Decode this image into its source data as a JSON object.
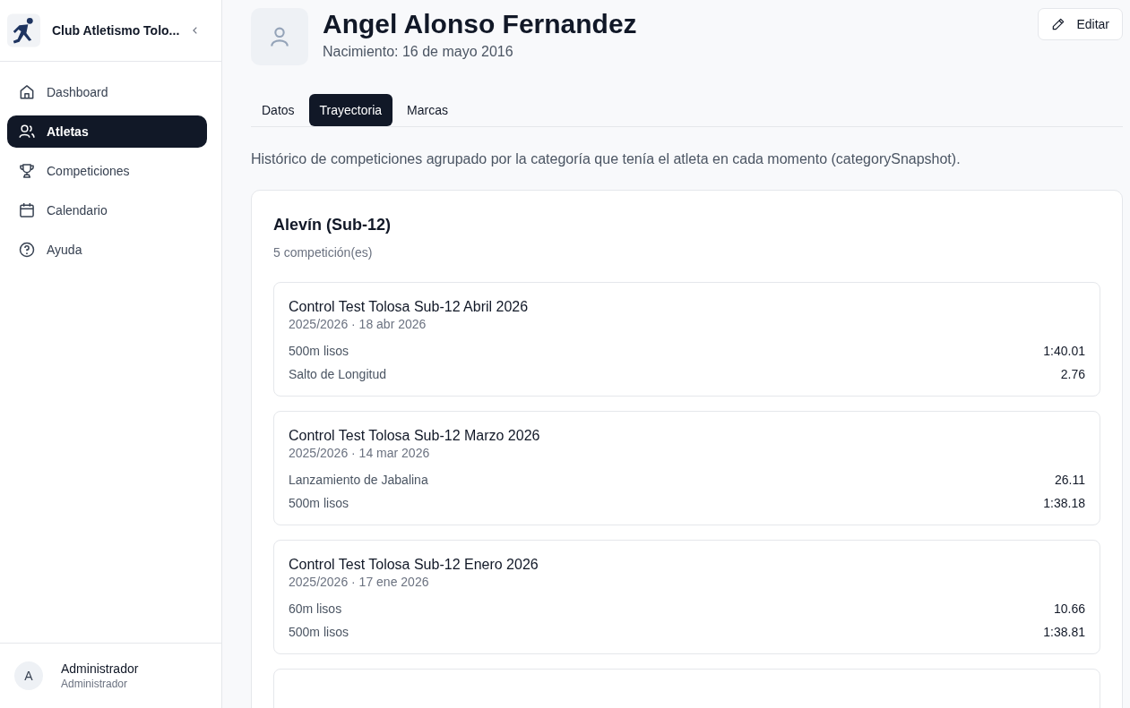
{
  "sidebar": {
    "club_name": "Club Atletismo Tolo...",
    "items": [
      {
        "label": "Dashboard",
        "selected": false
      },
      {
        "label": "Atletas",
        "selected": true
      },
      {
        "label": "Competiciones",
        "selected": false
      },
      {
        "label": "Calendario",
        "selected": false
      },
      {
        "label": "Ayuda",
        "selected": false
      }
    ],
    "user": {
      "initial": "A",
      "name": "Administrador",
      "role": "Administrador"
    }
  },
  "athlete": {
    "name": "Angel Alonso Fernandez",
    "birth": "Nacimiento: 16 de mayo 2016",
    "edit_button": "Editar"
  },
  "tabs": [
    {
      "label": "Datos",
      "selected": false
    },
    {
      "label": "Trayectoria",
      "selected": true
    },
    {
      "label": "Marcas",
      "selected": false
    }
  ],
  "description": "Histórico de competiciones agrupado por la categoría que tenía el atleta en cada momento (categorySnapshot).",
  "group": {
    "title": "Alevín (Sub-12)",
    "count": "5 competición(es)",
    "competitions": [
      {
        "name": "Control Test Tolosa Sub-12 Abril 2026",
        "meta": "2025/2026 · 18 abr 2026",
        "results": [
          {
            "event": "500m lisos",
            "mark": "1:40.01"
          },
          {
            "event": "Salto de Longitud",
            "mark": "2.76"
          }
        ]
      },
      {
        "name": "Control Test Tolosa Sub-12 Marzo 2026",
        "meta": "2025/2026 · 14 mar 2026",
        "results": [
          {
            "event": "Lanzamiento de Jabalina",
            "mark": "26.11"
          },
          {
            "event": "500m lisos",
            "mark": "1:38.18"
          }
        ]
      },
      {
        "name": "Control Test Tolosa Sub-12 Enero 2026",
        "meta": "2025/2026 · 17 ene 2026",
        "results": [
          {
            "event": "60m lisos",
            "mark": "10.66"
          },
          {
            "event": "500m lisos",
            "mark": "1:38.81"
          }
        ]
      }
    ]
  }
}
